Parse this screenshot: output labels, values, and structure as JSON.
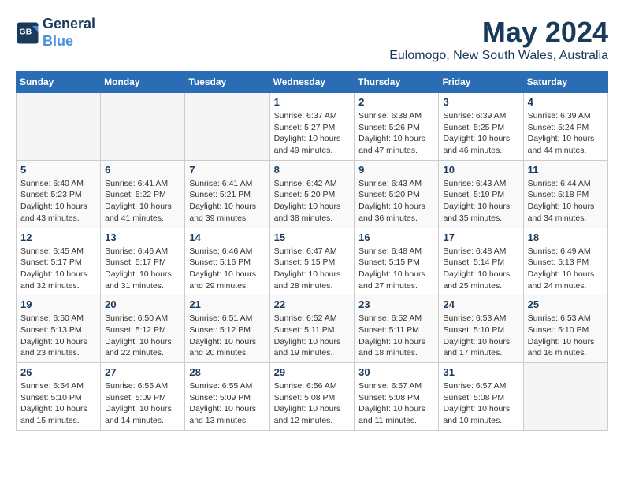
{
  "header": {
    "logo_line1": "General",
    "logo_line2": "Blue",
    "month": "May 2024",
    "location": "Eulomogo, New South Wales, Australia"
  },
  "weekdays": [
    "Sunday",
    "Monday",
    "Tuesday",
    "Wednesday",
    "Thursday",
    "Friday",
    "Saturday"
  ],
  "weeks": [
    [
      {
        "day": "",
        "empty": true
      },
      {
        "day": "",
        "empty": true
      },
      {
        "day": "",
        "empty": true
      },
      {
        "day": "1",
        "sunrise": "6:37 AM",
        "sunset": "5:27 PM",
        "daylight": "10 hours and 49 minutes."
      },
      {
        "day": "2",
        "sunrise": "6:38 AM",
        "sunset": "5:26 PM",
        "daylight": "10 hours and 47 minutes."
      },
      {
        "day": "3",
        "sunrise": "6:39 AM",
        "sunset": "5:25 PM",
        "daylight": "10 hours and 46 minutes."
      },
      {
        "day": "4",
        "sunrise": "6:39 AM",
        "sunset": "5:24 PM",
        "daylight": "10 hours and 44 minutes."
      }
    ],
    [
      {
        "day": "5",
        "sunrise": "6:40 AM",
        "sunset": "5:23 PM",
        "daylight": "10 hours and 43 minutes."
      },
      {
        "day": "6",
        "sunrise": "6:41 AM",
        "sunset": "5:22 PM",
        "daylight": "10 hours and 41 minutes."
      },
      {
        "day": "7",
        "sunrise": "6:41 AM",
        "sunset": "5:21 PM",
        "daylight": "10 hours and 39 minutes."
      },
      {
        "day": "8",
        "sunrise": "6:42 AM",
        "sunset": "5:20 PM",
        "daylight": "10 hours and 38 minutes."
      },
      {
        "day": "9",
        "sunrise": "6:43 AM",
        "sunset": "5:20 PM",
        "daylight": "10 hours and 36 minutes."
      },
      {
        "day": "10",
        "sunrise": "6:43 AM",
        "sunset": "5:19 PM",
        "daylight": "10 hours and 35 minutes."
      },
      {
        "day": "11",
        "sunrise": "6:44 AM",
        "sunset": "5:18 PM",
        "daylight": "10 hours and 34 minutes."
      }
    ],
    [
      {
        "day": "12",
        "sunrise": "6:45 AM",
        "sunset": "5:17 PM",
        "daylight": "10 hours and 32 minutes."
      },
      {
        "day": "13",
        "sunrise": "6:46 AM",
        "sunset": "5:17 PM",
        "daylight": "10 hours and 31 minutes."
      },
      {
        "day": "14",
        "sunrise": "6:46 AM",
        "sunset": "5:16 PM",
        "daylight": "10 hours and 29 minutes."
      },
      {
        "day": "15",
        "sunrise": "6:47 AM",
        "sunset": "5:15 PM",
        "daylight": "10 hours and 28 minutes."
      },
      {
        "day": "16",
        "sunrise": "6:48 AM",
        "sunset": "5:15 PM",
        "daylight": "10 hours and 27 minutes."
      },
      {
        "day": "17",
        "sunrise": "6:48 AM",
        "sunset": "5:14 PM",
        "daylight": "10 hours and 25 minutes."
      },
      {
        "day": "18",
        "sunrise": "6:49 AM",
        "sunset": "5:13 PM",
        "daylight": "10 hours and 24 minutes."
      }
    ],
    [
      {
        "day": "19",
        "sunrise": "6:50 AM",
        "sunset": "5:13 PM",
        "daylight": "10 hours and 23 minutes."
      },
      {
        "day": "20",
        "sunrise": "6:50 AM",
        "sunset": "5:12 PM",
        "daylight": "10 hours and 22 minutes."
      },
      {
        "day": "21",
        "sunrise": "6:51 AM",
        "sunset": "5:12 PM",
        "daylight": "10 hours and 20 minutes."
      },
      {
        "day": "22",
        "sunrise": "6:52 AM",
        "sunset": "5:11 PM",
        "daylight": "10 hours and 19 minutes."
      },
      {
        "day": "23",
        "sunrise": "6:52 AM",
        "sunset": "5:11 PM",
        "daylight": "10 hours and 18 minutes."
      },
      {
        "day": "24",
        "sunrise": "6:53 AM",
        "sunset": "5:10 PM",
        "daylight": "10 hours and 17 minutes."
      },
      {
        "day": "25",
        "sunrise": "6:53 AM",
        "sunset": "5:10 PM",
        "daylight": "10 hours and 16 minutes."
      }
    ],
    [
      {
        "day": "26",
        "sunrise": "6:54 AM",
        "sunset": "5:10 PM",
        "daylight": "10 hours and 15 minutes."
      },
      {
        "day": "27",
        "sunrise": "6:55 AM",
        "sunset": "5:09 PM",
        "daylight": "10 hours and 14 minutes."
      },
      {
        "day": "28",
        "sunrise": "6:55 AM",
        "sunset": "5:09 PM",
        "daylight": "10 hours and 13 minutes."
      },
      {
        "day": "29",
        "sunrise": "6:56 AM",
        "sunset": "5:08 PM",
        "daylight": "10 hours and 12 minutes."
      },
      {
        "day": "30",
        "sunrise": "6:57 AM",
        "sunset": "5:08 PM",
        "daylight": "10 hours and 11 minutes."
      },
      {
        "day": "31",
        "sunrise": "6:57 AM",
        "sunset": "5:08 PM",
        "daylight": "10 hours and 10 minutes."
      },
      {
        "day": "",
        "empty": true
      }
    ]
  ]
}
